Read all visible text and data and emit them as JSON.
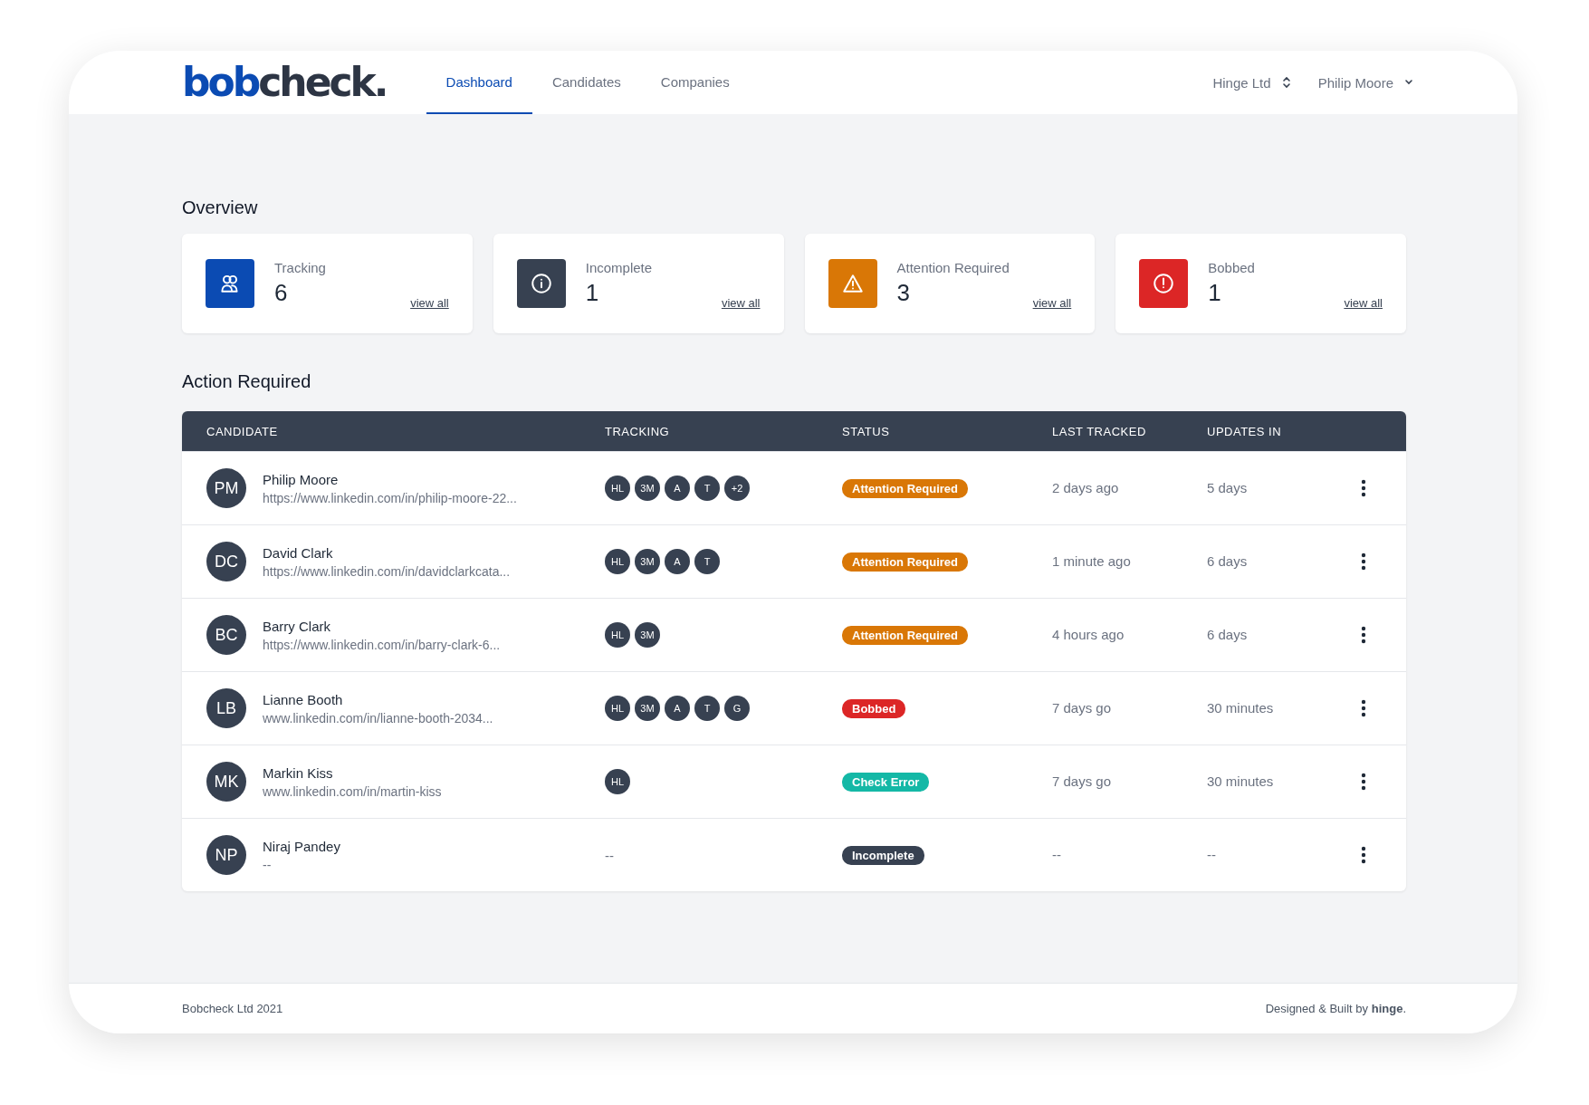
{
  "logo": [
    {
      "text": "bob",
      "color": "#0b4bb3"
    },
    {
      "text": "check.",
      "color": "#2d3544"
    }
  ],
  "nav": [
    {
      "label": "Dashboard",
      "selected": true
    },
    {
      "label": "Candidates",
      "selected": false
    },
    {
      "label": "Companies",
      "selected": false
    }
  ],
  "company_switcher": "Hinge Ltd",
  "user_menu": "Philip Moore",
  "overview": {
    "title": "Overview",
    "cards": [
      {
        "kind": "tracking",
        "label": "Tracking",
        "count": "6",
        "link": "view all",
        "color": "#0b4bb3"
      },
      {
        "kind": "info",
        "label": "Incomplete",
        "count": "1",
        "link": "view all",
        "color": "#374151"
      },
      {
        "kind": "warning",
        "label": "Attention Required",
        "count": "3",
        "link": "view all",
        "color": "#d97706"
      },
      {
        "kind": "alert",
        "label": "Bobbed",
        "count": "1",
        "link": "view all",
        "color": "#dc2626"
      }
    ]
  },
  "action_required": {
    "title": "Action Required",
    "columns": [
      "CANDIDATE",
      "TRACKING",
      "STATUS",
      "LAST TRACKED",
      "UPDATES IN"
    ],
    "rows": [
      {
        "initials": "PM",
        "name": "Philip Moore",
        "url": "https://www.linkedin.com/in/philip-moore-22...",
        "tracking": [
          "HL",
          "3M",
          "A",
          "T",
          "+2"
        ],
        "status": {
          "label": "Attention Required",
          "color": "#d97706"
        },
        "last_tracked": "2 days ago",
        "updates_in": "5 days"
      },
      {
        "initials": "DC",
        "name": "David Clark",
        "url": "https://www.linkedin.com/in/davidclarkcata...",
        "tracking": [
          "HL",
          "3M",
          "A",
          "T"
        ],
        "status": {
          "label": "Attention Required",
          "color": "#d97706"
        },
        "last_tracked": "1 minute ago",
        "updates_in": "6 days"
      },
      {
        "initials": "BC",
        "name": "Barry Clark",
        "url": "https://www.linkedin.com/in/barry-clark-6...",
        "tracking": [
          "HL",
          "3M"
        ],
        "status": {
          "label": "Attention Required",
          "color": "#d97706"
        },
        "last_tracked": "4 hours ago",
        "updates_in": "6 days"
      },
      {
        "initials": "LB",
        "name": "Lianne Booth",
        "url": "www.linkedin.com/in/lianne-booth-2034...",
        "tracking": [
          "HL",
          "3M",
          "A",
          "T",
          "G"
        ],
        "status": {
          "label": "Bobbed",
          "color": "#dc2626"
        },
        "last_tracked": "7 days go",
        "updates_in": "30 minutes"
      },
      {
        "initials": "MK",
        "name": "Markin Kiss",
        "url": "www.linkedin.com/in/martin-kiss",
        "tracking": [
          "HL"
        ],
        "status": {
          "label": "Check Error",
          "color": "#14b8a6"
        },
        "last_tracked": "7 days go",
        "updates_in": "30 minutes"
      },
      {
        "initials": "NP",
        "name": "Niraj Pandey",
        "url": "--",
        "tracking": "--",
        "status": {
          "label": "Incomplete",
          "color": "#374151"
        },
        "last_tracked": "--",
        "updates_in": "--"
      }
    ]
  },
  "footer": {
    "copyright": "Bobcheck Ltd 2021",
    "credit": "Designed & Built by **hinge**."
  }
}
